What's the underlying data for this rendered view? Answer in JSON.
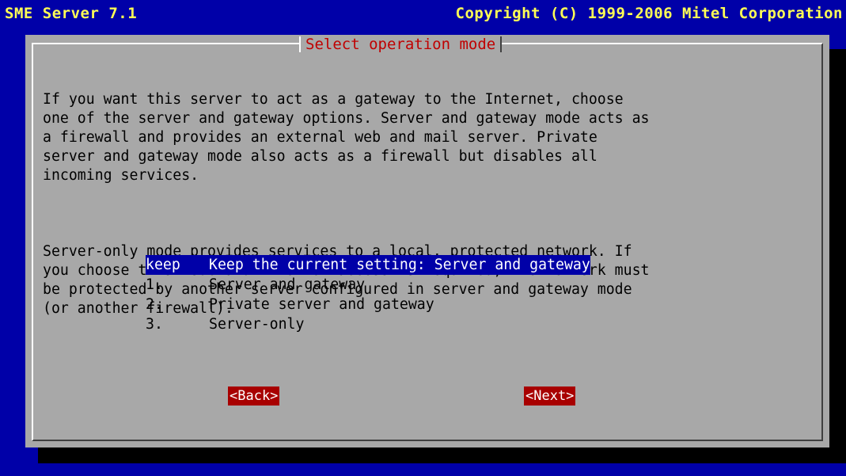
{
  "header": {
    "left": "SME Server 7.1",
    "right": "Copyright (C) 1999-2006 Mitel Corporation"
  },
  "dialog": {
    "title": "Select operation mode",
    "paragraph1": "If you want this server to act as a gateway to the Internet, choose\none of the server and gateway options. Server and gateway mode acts as\na firewall and provides an external web and mail server. Private\nserver and gateway mode also acts as a firewall but disables all\nincoming services.",
    "paragraph2": "Server-only mode provides services to a local, protected network. If\nyou choose this mode and Internet access is required, the network must\nbe protected by another server configured in server and gateway mode\n(or another firewall).",
    "options": [
      {
        "tag": "keep",
        "text": "Keep the current setting: Server and gateway",
        "selected": true
      },
      {
        "tag": "1.",
        "text": "Server and gateway",
        "selected": false
      },
      {
        "tag": "2.",
        "text": "Private server and gateway",
        "selected": false
      },
      {
        "tag": "3.",
        "text": "Server-only",
        "selected": false
      }
    ],
    "back_label": "<Back>",
    "next_label": "<Next>"
  },
  "colors": {
    "background": "#0000a8",
    "dialog": "#a8a8a8",
    "title_text": "#c00000",
    "button_bg": "#a80000",
    "header_text": "#ffff55"
  }
}
